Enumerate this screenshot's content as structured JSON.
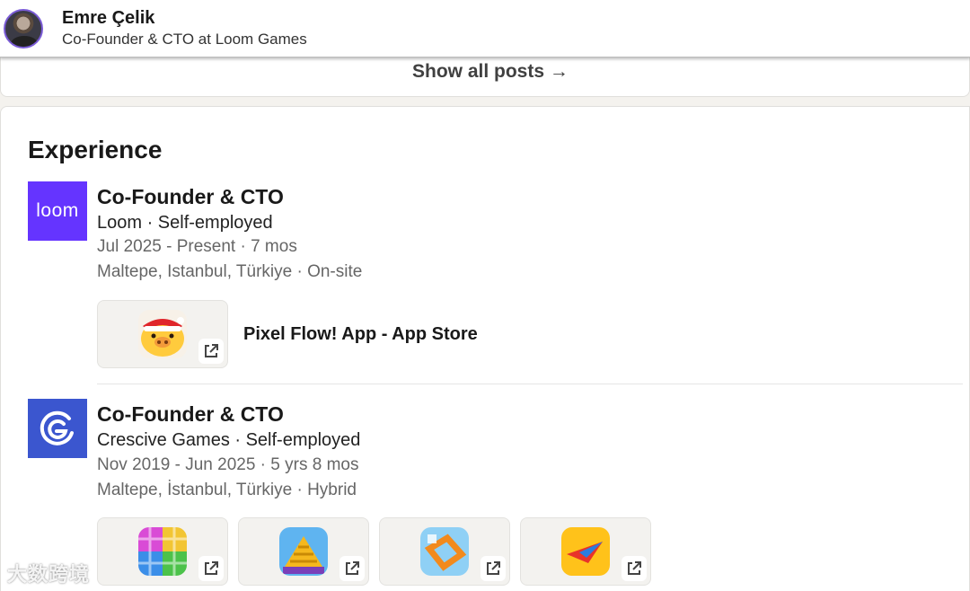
{
  "header": {
    "name": "Emre Çelik",
    "headline": "Co-Founder & CTO at Loom Games"
  },
  "posts": {
    "show_all_label": "Show all posts →"
  },
  "experience": {
    "section_title": "Experience",
    "items": [
      {
        "logo_text": "loom",
        "logo_color": "#6534ff",
        "title": "Co-Founder & CTO",
        "company": "Loom · Self-employed",
        "dates": "Jul 2025 - Present · 7 mos",
        "location": "Maltepe, Istanbul, Türkiye · On-site",
        "media": [
          {
            "icon": "pig-santa-app-icon",
            "label": "Pixel Flow! App - App Store"
          }
        ]
      },
      {
        "logo_text": "",
        "logo_color": "#3b56cf",
        "title": "Co-Founder & CTO",
        "company": "Crescive Games · Self-employed",
        "dates": "Nov 2019 - Jun 2025 · 5 yrs 8 mos",
        "location": "Maltepe, İstanbul, Türkiye · Hybrid",
        "media": [
          {
            "icon": "yarn-puzzle-app-icon"
          },
          {
            "icon": "gold-blocks-app-icon"
          },
          {
            "icon": "orange-frame-app-icon"
          },
          {
            "icon": "paper-plane-app-icon"
          }
        ]
      }
    ]
  },
  "watermark": {
    "text": "大数跨境"
  }
}
